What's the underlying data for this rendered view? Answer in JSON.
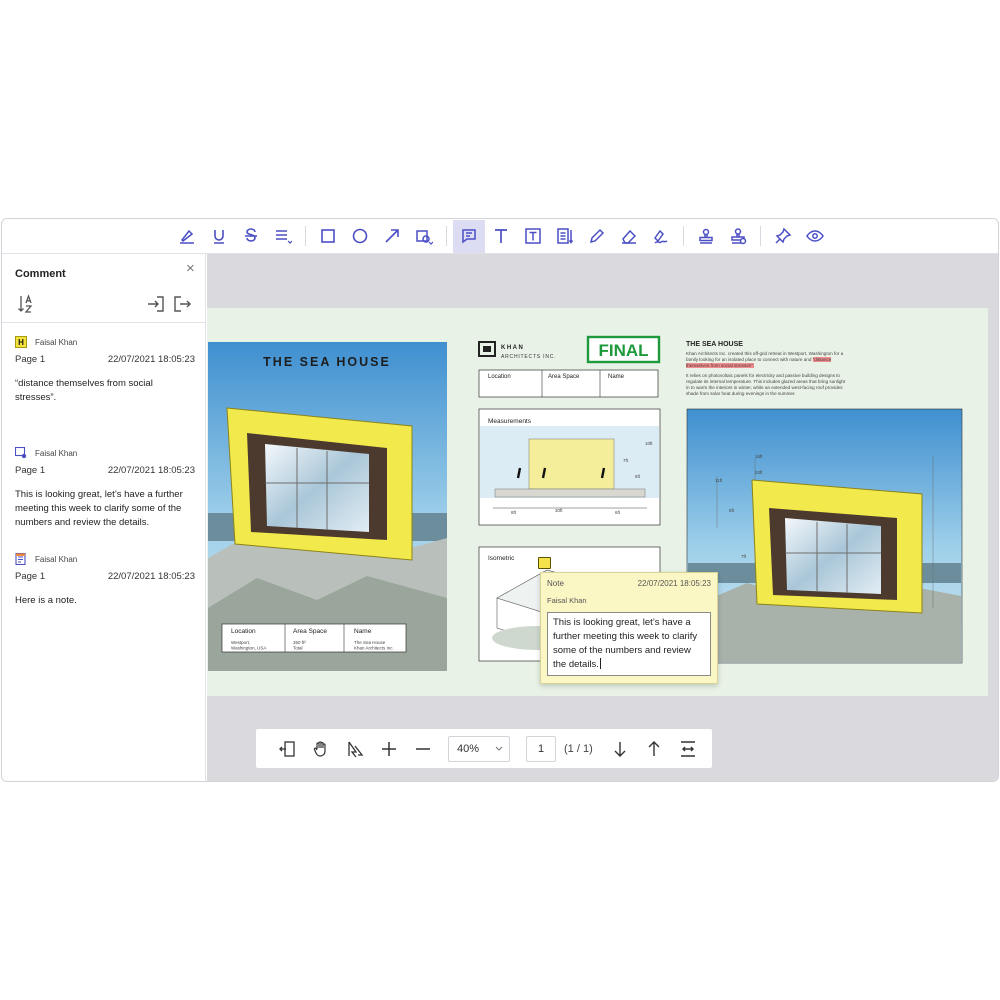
{
  "toolbar": {
    "tools": [
      "highlight",
      "underline",
      "strikeout",
      "text-align",
      "rectangle",
      "ellipse",
      "arrow",
      "shape-menu",
      "comment",
      "free-text",
      "text-box",
      "note",
      "pencil",
      "eraser",
      "signature",
      "stamp",
      "user-stamp",
      "pin",
      "view"
    ],
    "active": "comment"
  },
  "panel": {
    "title": "Comment",
    "comments": [
      {
        "type": "highlight",
        "icon_letter": "H",
        "author": "Faisal Khan",
        "page": "Page 1",
        "date": "22/07/2021 18:05:23",
        "text": "“distance themselves from social stresses”."
      },
      {
        "type": "comment",
        "author": "Faisal Khan",
        "page": "Page 1",
        "date": "22/07/2021 18:05:23",
        "text": "This is looking great, let’s have a further meeting this week to clarify some of the numbers and review the details."
      },
      {
        "type": "note",
        "author": "Faisal Khan",
        "page": "Page 1",
        "date": "22/07/2021 18:05:23",
        "text": "Here is a note."
      }
    ]
  },
  "document": {
    "title_left": "THE SEA HOUSE",
    "firm_name": "KHAN",
    "firm_sub": "ARCHITECTS INC.",
    "stamp": "FINAL",
    "info_headers": [
      "Location",
      "Area Space",
      "Name"
    ],
    "info_values": [
      "Westport,\nWashington, USA",
      "350 ft²\nTotal",
      "The Sea House\nKhan Architects Inc."
    ],
    "measurements_label": "Measurements",
    "isometric_label": "Isometric",
    "title_right": "THE SEA HOUSE",
    "para1": "Khan Architects Inc. created this off-grid retreat in Westport, Washington for a family looking for an isolated place to connect with nature and",
    "para1_highlight": "“distance themselves from social stresses”.",
    "para2": "It relies on photovoltaic panels for electricity and passive building designs to regulate its internal temperature. This includes glazed areas that bring sunlight in to warm the interiors in winter, while an extended west-facing roof provides shade from solar heat during evenings in the summer.",
    "dims_measure": [
      "10ft",
      "7ft",
      "30ft",
      "6ft",
      "8ft"
    ],
    "dims_side": [
      "10ft",
      "7ft",
      "6ft"
    ],
    "dims_render": [
      "16ft",
      "22ft",
      "11ft",
      "6ft",
      "7ft"
    ]
  },
  "note_popup": {
    "label": "Note",
    "date": "22/07/2021 18:05:23",
    "author": "Faisal Khan",
    "text": "This is looking great, let’s have a further meeting this week to clarify some of the numbers and review the details."
  },
  "zoom_bar": {
    "zoom": "40%",
    "page": "1",
    "page_of": "(1 / 1)"
  },
  "colors": {
    "accent": "#4b4fc4",
    "active_tool_bg": "#dcdcf2",
    "canvas_bg": "#d9d9de",
    "sheet_bg": "#e9f2e6",
    "stamp_green": "#1e9a3c",
    "note_yellow": "#fbf7c4",
    "highlight_red": "#f28b8b"
  }
}
